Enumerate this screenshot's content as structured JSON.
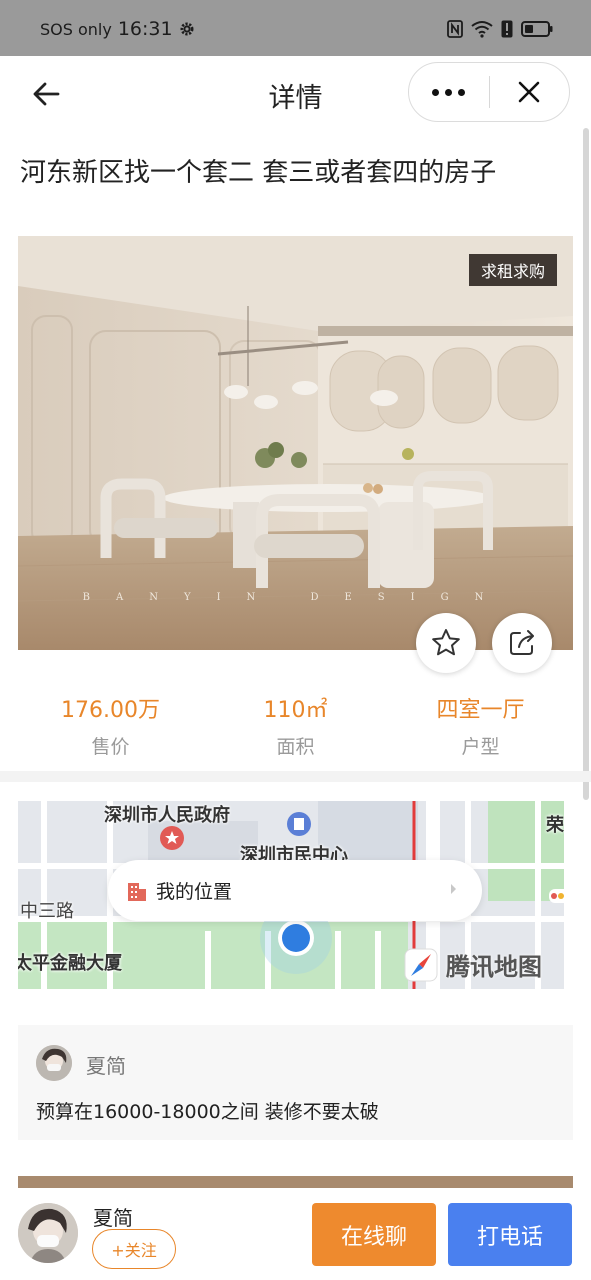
{
  "status_bar": {
    "carrier": "SOS only",
    "time": "16:31",
    "icons": [
      "settings-gear-icon",
      "nfc-icon",
      "wifi-icon",
      "alert-icon",
      "battery-icon"
    ]
  },
  "nav": {
    "title": "详情",
    "back_icon": "arrow-left-icon",
    "more_icon": "more-dots-icon",
    "close_icon": "close-icon"
  },
  "post": {
    "title": "河东新区找一个套二 套三或者套四的房子",
    "badge": "求租求购",
    "image_watermark": "BANYIN DESIGN"
  },
  "stats": [
    {
      "value": "176.00万",
      "label": "售价"
    },
    {
      "value": "110㎡",
      "label": "面积"
    },
    {
      "value": "四室一厅",
      "label": "户型"
    }
  ],
  "map": {
    "labels": {
      "gov": "深圳市人民政府",
      "civic": "深圳市民中心",
      "road": "中三路",
      "building": "太平金融大厦",
      "edge": "荣"
    },
    "location_button": "我的位置",
    "provider": "腾讯地图"
  },
  "comment": {
    "user": "夏简",
    "text": "预算在16000-18000之间 装修不要太破"
  },
  "bottom": {
    "user": "夏简",
    "follow": "+关注",
    "chat": "在线聊",
    "call": "打电话"
  },
  "colors": {
    "accent_orange": "#e8862a",
    "call_blue": "#4a80ef",
    "status_bar": "#9a9a9a"
  }
}
